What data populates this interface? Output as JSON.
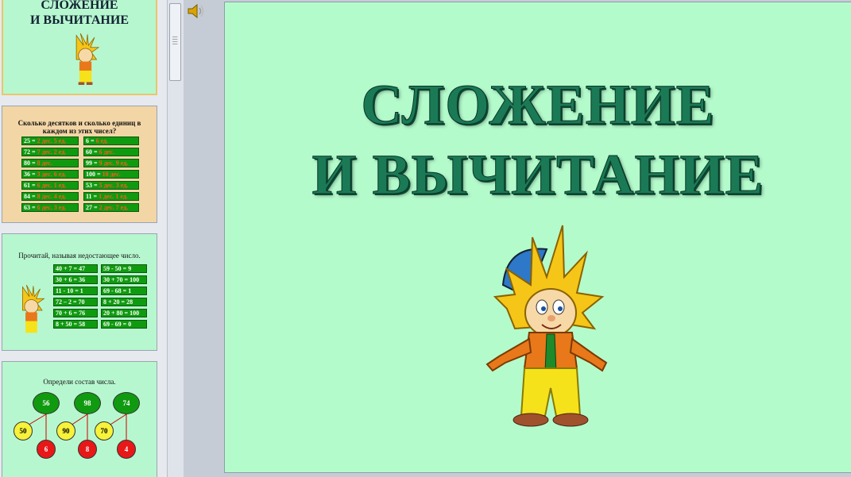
{
  "slide_main": {
    "title_line1": "СЛОЖЕНИЕ",
    "title_line2": "И ВЫЧИТАНИЕ"
  },
  "thumbs": {
    "t1": {
      "line1": "СЛОЖЕНИЕ",
      "line2": "И ВЫЧИТАНИЕ"
    },
    "t2": {
      "heading": "Сколько десятков и сколько единиц в каждом из этих чисел?",
      "rows": [
        [
          "25 =",
          "2 дес. 5 ед.",
          "6  =",
          "6 ед."
        ],
        [
          "72 =",
          "7 дес. 2 ед.",
          "60 =",
          "6 дес."
        ],
        [
          "80 =",
          "8 дес.",
          "99 =",
          "9 дес. 9 ед."
        ],
        [
          "36 =",
          "3 дес. 6 ед.",
          "100 =",
          "10 дес."
        ],
        [
          "61 =",
          "6 дес. 1 ед.",
          "53 =",
          "5 дес. 3 ед."
        ],
        [
          "84 =",
          "8 дес. 4 ед.",
          "11 =",
          "1 дес. 1 ед."
        ],
        [
          "63 =",
          "6 дес. 3 ед.",
          "27 =",
          "2 дес. 7 ед."
        ]
      ]
    },
    "t3": {
      "heading": "Прочитай, называя недостающее число.",
      "left": [
        "40 + 7 = 47",
        "30 + 6 = 36",
        "11 - 10 = 1",
        "72 – 2 = 70",
        "70 + 6 = 76",
        "8 + 50 = 58"
      ],
      "right": [
        "59 - 50 = 9",
        "30 + 70 = 100",
        "69 - 68 = 1",
        "8 + 20 = 28",
        "20 + 80 = 100",
        "69 - 69 = 0"
      ]
    },
    "t4": {
      "heading": "Определи состав числа.",
      "top": [
        "56",
        "98",
        "74"
      ],
      "yellow": [
        "50",
        "90",
        "70"
      ],
      "red": [
        "6",
        "8",
        "4"
      ]
    }
  },
  "icons": {
    "speaker": "speaker-icon",
    "grip": "scroll-grip-icon",
    "character": "cartoon-boy-illustration"
  },
  "colors": {
    "slide_bg": "#b4fbcc",
    "title": "#1a7a55",
    "tan_slide": "#f3d6a6",
    "green_cell": "#109a10"
  }
}
